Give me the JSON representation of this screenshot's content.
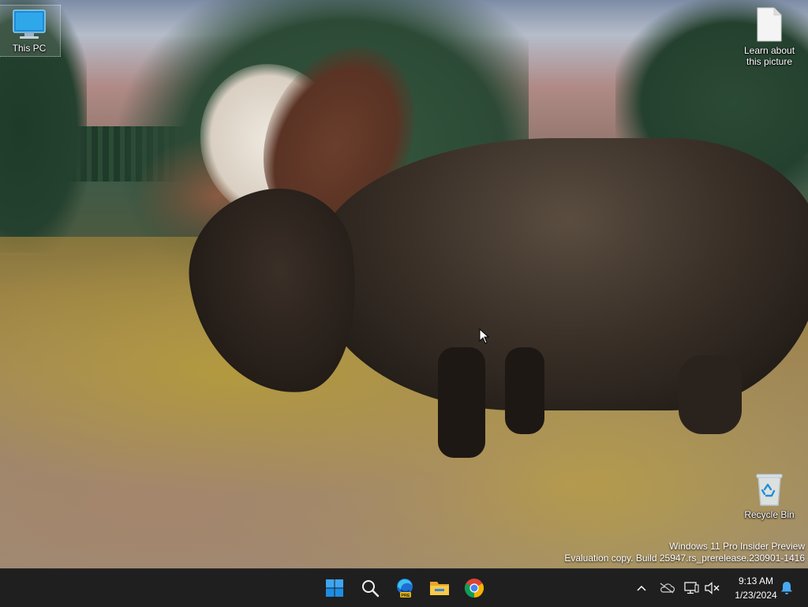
{
  "desktop": {
    "icons": [
      {
        "label": "This PC"
      },
      {
        "label": "Learn about this picture"
      },
      {
        "label": "Recycle Bin"
      }
    ],
    "watermark": {
      "line1": "Windows 11 Pro Insider Preview",
      "line2": "Evaluation copy. Build 25947.rs_prerelease.230901-1416"
    }
  },
  "taskbar": {
    "apps": [
      "start",
      "search",
      "edge-beta",
      "file-explorer",
      "chrome"
    ],
    "clock": {
      "time": "9:13 AM",
      "date": "1/23/2024"
    },
    "colors": {
      "background": "#1f1f1f",
      "accent": "#0078d4"
    }
  }
}
